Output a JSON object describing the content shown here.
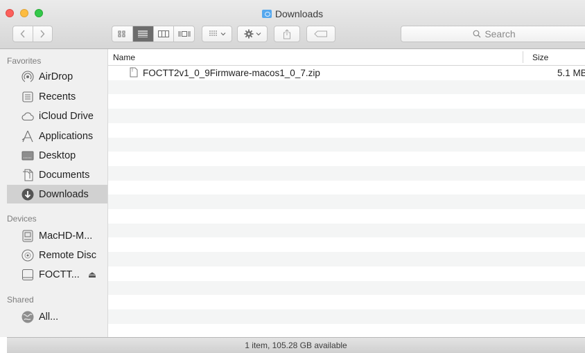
{
  "window": {
    "title": "Downloads"
  },
  "toolbar": {
    "back_icon": "chevron-left-icon",
    "forward_icon": "chevron-right-icon",
    "views": [
      "icon-view-icon",
      "list-view-icon",
      "column-view-icon",
      "cover-flow-icon"
    ],
    "active_view": "list",
    "arrange_icon": "arrange-icon",
    "action_icon": "gear-icon",
    "share_icon": "share-icon",
    "tag_icon": "tag-icon",
    "search_placeholder": "Search"
  },
  "sidebar": {
    "favorites_title": "Favorites",
    "favorites": [
      {
        "label": "AirDrop",
        "icon": "airdrop-icon"
      },
      {
        "label": "Recents",
        "icon": "recents-icon"
      },
      {
        "label": "iCloud Drive",
        "icon": "cloud-icon"
      },
      {
        "label": "Applications",
        "icon": "applications-icon"
      },
      {
        "label": "Desktop",
        "icon": "desktop-icon"
      },
      {
        "label": "Documents",
        "icon": "documents-icon"
      },
      {
        "label": "Downloads",
        "icon": "downloads-icon",
        "selected": true
      }
    ],
    "devices_title": "Devices",
    "devices": [
      {
        "label": "MacHD-M...",
        "icon": "hard-drive-icon"
      },
      {
        "label": "Remote Disc",
        "icon": "disc-icon"
      },
      {
        "label": "FOCTT...",
        "icon": "external-drive-icon",
        "eject": "⏏"
      }
    ],
    "shared_title": "Shared",
    "shared": [
      {
        "label": "All...",
        "icon": "network-icon"
      }
    ]
  },
  "list": {
    "columns": {
      "name": "Name",
      "size": "Size"
    },
    "files": [
      {
        "name": "FOCTT2v1_0_9Firmware-macos1_0_7.zip",
        "size": "5.1 MB",
        "icon": "zip-file-icon"
      }
    ]
  },
  "status": {
    "text": "1 item, 105.28 GB available"
  },
  "colors": {
    "close": "#fc605c",
    "minimize": "#fdbc40",
    "maximize": "#34c84a",
    "folder": "#55a8ee",
    "selected_row": "#d1d1d1",
    "stripe": "#f4f5f5"
  }
}
